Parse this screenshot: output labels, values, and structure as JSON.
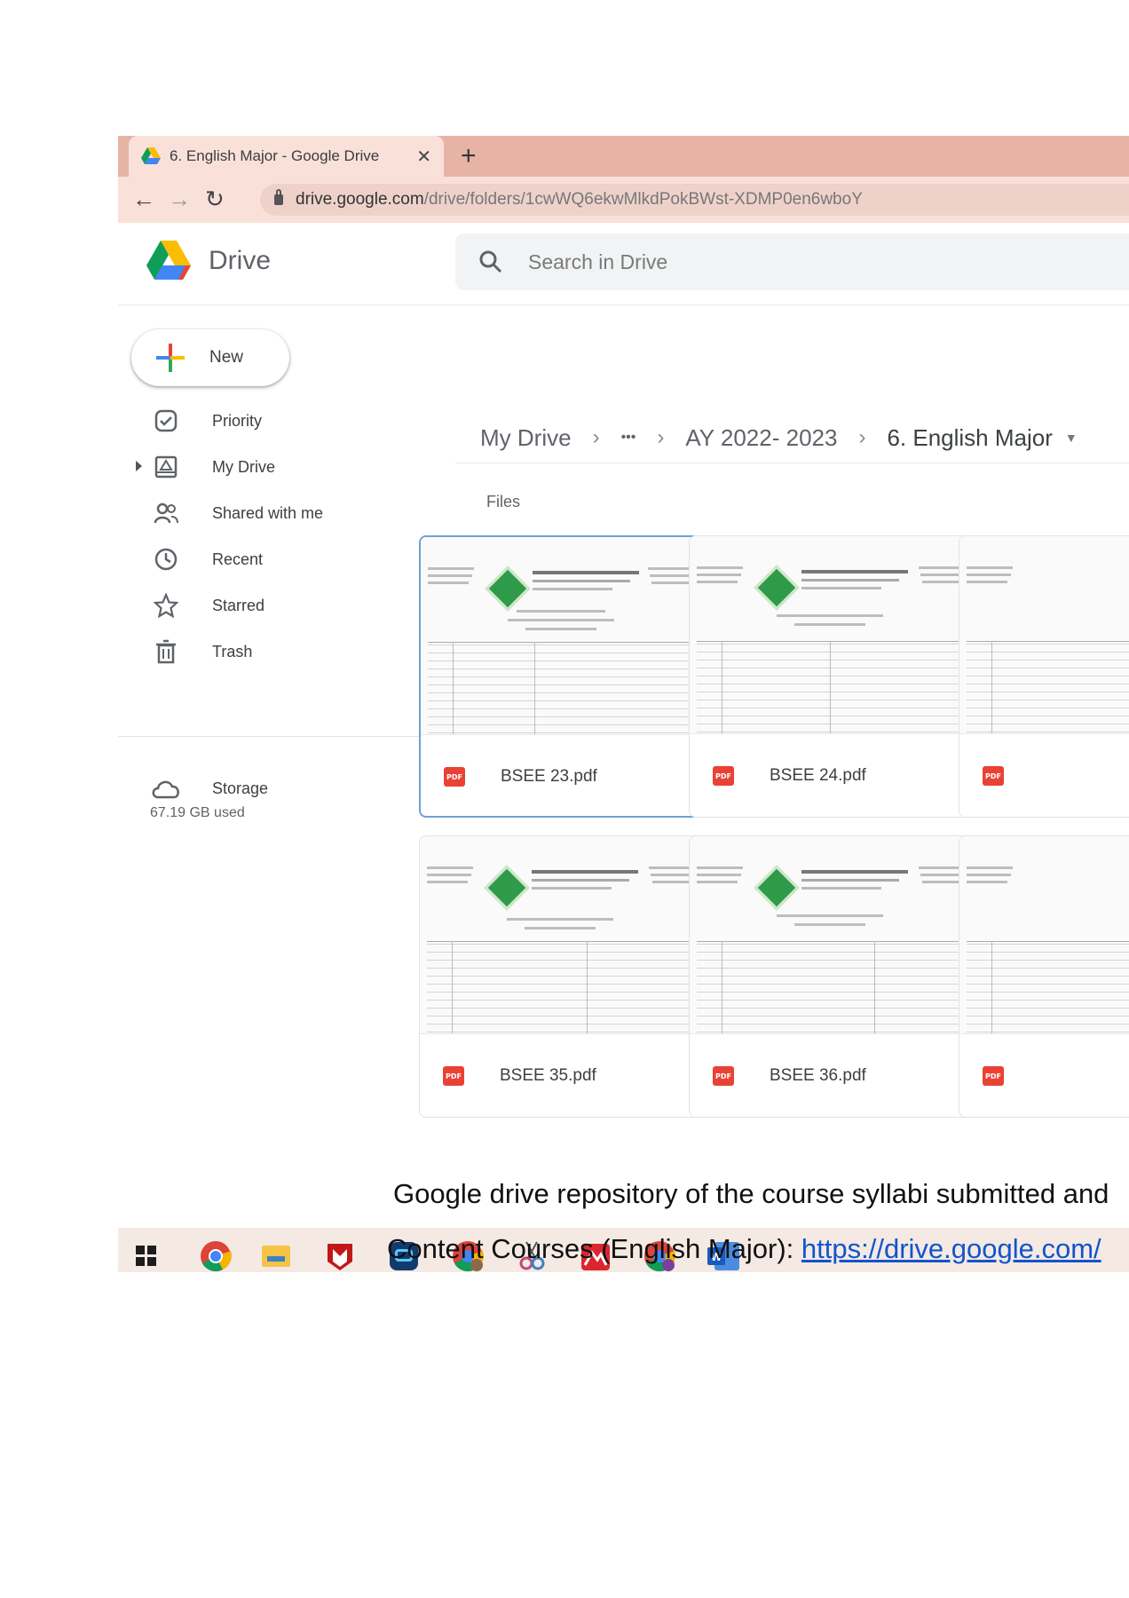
{
  "browser": {
    "tab_title": "6. English Major - Google Drive",
    "tab_close": "✕",
    "new_tab": "+",
    "url_main": "drive.google.com",
    "url_path": "/drive/folders/1cwWQ6ekwMlkdPokBWst-XDMP0en6wboY"
  },
  "drive": {
    "brand": "Drive",
    "search_placeholder": "Search in Drive"
  },
  "sidebar": {
    "new_label": "New",
    "items": [
      {
        "label": "Priority",
        "icon": "priority-icon"
      },
      {
        "label": "My Drive",
        "icon": "my-drive-icon"
      },
      {
        "label": "Shared with me",
        "icon": "shared-icon"
      },
      {
        "label": "Recent",
        "icon": "clock-icon"
      },
      {
        "label": "Starred",
        "icon": "star-icon"
      },
      {
        "label": "Trash",
        "icon": "trash-icon"
      }
    ],
    "storage_label": "Storage",
    "storage_used": "67.19 GB used"
  },
  "breadcrumb": {
    "root": "My Drive",
    "ellipsis": "•••",
    "parent": "AY 2022- 2023",
    "current": "6. English Major"
  },
  "main": {
    "section_label": "Files",
    "files": [
      {
        "name": "BSEE 23.pdf",
        "selected": true
      },
      {
        "name": "BSEE 24.pdf",
        "selected": false
      },
      {
        "name": "",
        "selected": false
      },
      {
        "name": "BSEE 35.pdf",
        "selected": false
      },
      {
        "name": "BSEE 36.pdf",
        "selected": false
      },
      {
        "name": "",
        "selected": false
      }
    ],
    "file_type_badge": "PDF"
  },
  "taskbar": {
    "apps": [
      "windows-start-icon",
      "chrome-icon",
      "file-explorer-icon",
      "mcafee-icon",
      "app-icon",
      "chrome-profile-icon",
      "snipping-tool-icon",
      "photo-app-icon",
      "chrome-profile-2-icon",
      "word-icon"
    ]
  },
  "caption": {
    "line1": "Google drive repository of the course syllabi submitted and",
    "line2_prefix": "Content Courses (English Major): ",
    "line2_link": "https://drive.google.com/"
  }
}
